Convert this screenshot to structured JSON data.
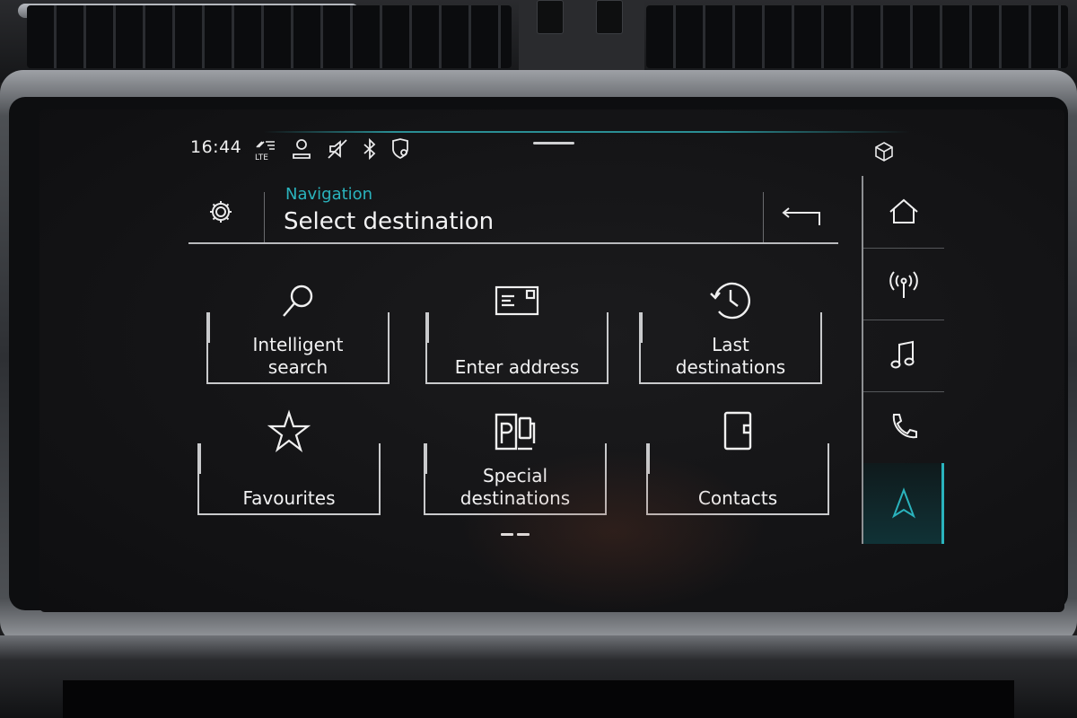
{
  "status_bar": {
    "time": "16:44",
    "network": "LTE",
    "icons": [
      "lte-signal-icon",
      "user-profile-icon",
      "mute-icon",
      "bluetooth-icon",
      "location-shield-icon"
    ],
    "top_right_icon": "cube-icon"
  },
  "header": {
    "subtitle": "Navigation",
    "title": "Select destination",
    "settings_icon": "gear-icon",
    "back_icon": "back-arrow-icon"
  },
  "tiles": [
    {
      "label": "Intelligent\nsearch",
      "icon": "search-icon"
    },
    {
      "label": "Enter address",
      "icon": "envelope-icon"
    },
    {
      "label": "Last\ndestinations",
      "icon": "history-clock-icon"
    },
    {
      "label": "Favourites",
      "icon": "star-icon"
    },
    {
      "label": "Special\ndestinations",
      "icon": "parking-fuel-icon"
    },
    {
      "label": "Contacts",
      "icon": "contacts-book-icon"
    }
  ],
  "rail": [
    {
      "icon": "home-icon",
      "active": false
    },
    {
      "icon": "radio-antenna-icon",
      "active": false
    },
    {
      "icon": "music-note-icon",
      "active": false
    },
    {
      "icon": "phone-icon",
      "active": false
    },
    {
      "icon": "navigation-arrow-icon",
      "active": true
    }
  ],
  "pager": {
    "page": 1,
    "pages": 2
  },
  "colors": {
    "accent": "#2ab3bd",
    "text": "#f2f2f3",
    "background": "#141416"
  }
}
